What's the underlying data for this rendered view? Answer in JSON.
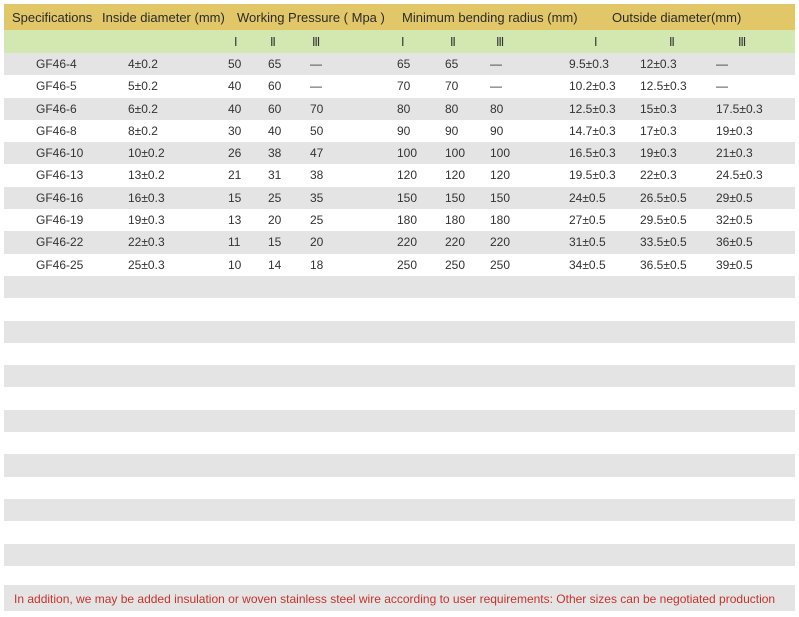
{
  "headers": {
    "specifications": "Specifications",
    "inside_diameter": "Inside diameter (mm)",
    "working_pressure": "Working Pressure ( Mpa )",
    "min_bending_radius": "Minimum bending radius (mm)",
    "outside_diameter": "Outside diameter(mm)"
  },
  "subheaders": [
    "Ⅰ",
    "Ⅱ",
    "Ⅲ",
    "Ⅰ",
    "Ⅱ",
    "Ⅲ",
    "Ⅰ",
    "Ⅱ",
    "Ⅲ"
  ],
  "rows": [
    [
      "GF46-4",
      "4±0.2",
      "50",
      "65",
      "—",
      "65",
      "65",
      "—",
      "9.5±0.3",
      "12±0.3",
      "—"
    ],
    [
      "GF46-5",
      "5±0.2",
      "40",
      "60",
      "—",
      "70",
      "70",
      "—",
      "10.2±0.3",
      "12.5±0.3",
      "—"
    ],
    [
      "GF46-6",
      "6±0.2",
      "40",
      "60",
      "70",
      "80",
      "80",
      "80",
      "12.5±0.3",
      "15±0.3",
      "17.5±0.3"
    ],
    [
      "GF46-8",
      "8±0.2",
      "30",
      "40",
      "50",
      "90",
      "90",
      "90",
      "14.7±0.3",
      "17±0.3",
      "19±0.3"
    ],
    [
      "GF46-10",
      "10±0.2",
      "26",
      "38",
      "47",
      "100",
      "100",
      "100",
      "16.5±0.3",
      "19±0.3",
      "21±0.3"
    ],
    [
      "GF46-13",
      "13±0.2",
      "21",
      "31",
      "38",
      "120",
      "120",
      "120",
      "19.5±0.3",
      "22±0.3",
      "24.5±0.3"
    ],
    [
      "GF46-16",
      "16±0.3",
      "15",
      "25",
      "35",
      "150",
      "150",
      "150",
      "24±0.5",
      "26.5±0.5",
      "29±0.5"
    ],
    [
      "GF46-19",
      "19±0.3",
      "13",
      "20",
      "25",
      "180",
      "180",
      "180",
      "27±0.5",
      "29.5±0.5",
      "32±0.5"
    ],
    [
      "GF46-22",
      "22±0.3",
      "11",
      "15",
      "20",
      "220",
      "220",
      "220",
      "31±0.5",
      "33.5±0.5",
      "36±0.5"
    ],
    [
      "GF46-25",
      "25±0.3",
      "10",
      "14",
      "18",
      "250",
      "250",
      "250",
      "34±0.5",
      "36.5±0.5",
      "39±0.5"
    ]
  ],
  "footer_note": "In addition, we may be added insulation or woven stainless steel wire according to user requirements: Other sizes can be negotiated production",
  "colors": {
    "header_bg": "#e2c768",
    "subheader_bg": "#d3e8b0",
    "stripe_bg": "#e4e4e4",
    "note_text": "#c8322d"
  }
}
